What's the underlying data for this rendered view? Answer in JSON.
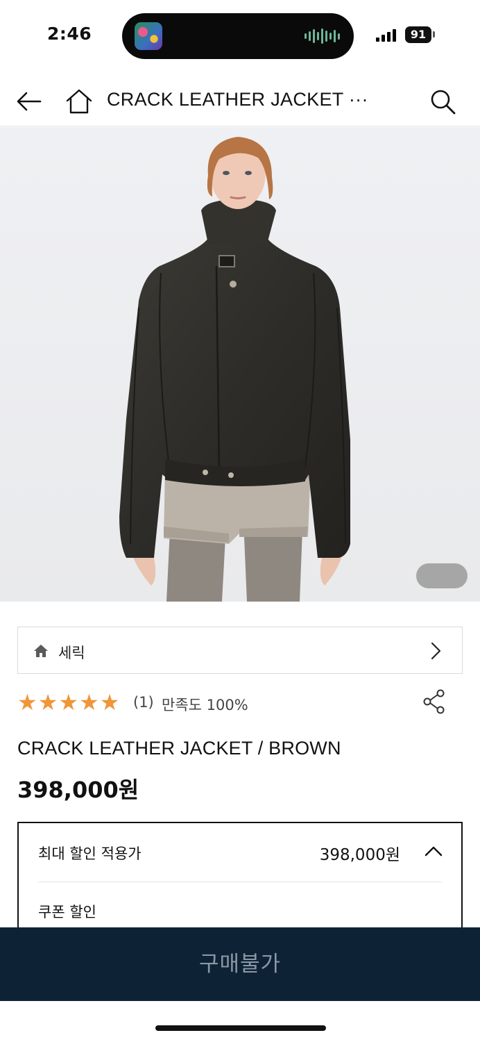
{
  "status_bar": {
    "time": "2:46",
    "battery": "91",
    "app_icon": "music-app-icon",
    "waveform_color": "#6fb59a"
  },
  "nav": {
    "title": "CRACK LEATHER JACKET ···",
    "back_icon": "arrow-left-icon",
    "home_icon": "home-icon",
    "search_icon": "search-icon"
  },
  "product": {
    "brand": "세릭",
    "rating_stars": 5,
    "review_count": "(1)",
    "satisfaction": "만족도 100%",
    "name": "CRACK LEATHER JACKET / BROWN",
    "price": "398,000원",
    "star_color": "#f0963a"
  },
  "discount": {
    "label": "최대 할인 적용가",
    "price": "398,000원",
    "coupon_label": "쿠폰 할인"
  },
  "buy_bar": {
    "label": "구매불가",
    "background": "#0e2236"
  }
}
